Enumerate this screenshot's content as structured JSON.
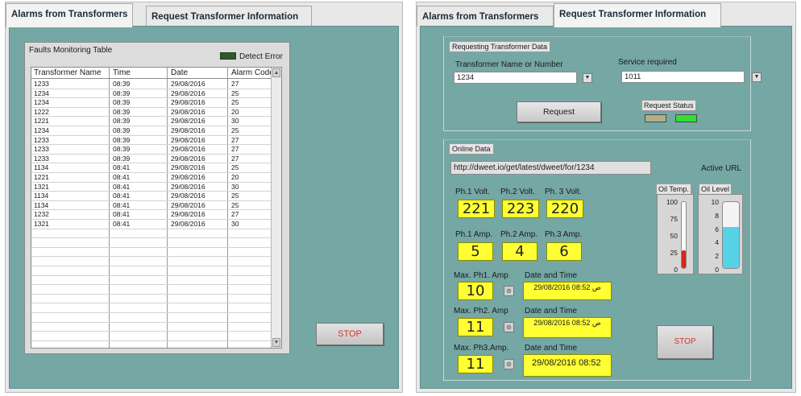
{
  "left": {
    "tabs": [
      "Alarms from Transformers",
      "Request Transformer Information"
    ],
    "faults_title": "Faults Monitoring Table",
    "detect_error_label": "Detect Error",
    "table": {
      "columns": [
        "Transformer Name",
        "Time",
        "Date",
        "Alarm Code"
      ],
      "rows": [
        [
          "1233",
          "08:39",
          "29/08/2016",
          "27"
        ],
        [
          "1234",
          "08:39",
          "29/08/2016",
          "25"
        ],
        [
          "1234",
          "08:39",
          "29/08/2016",
          "25"
        ],
        [
          "1222",
          "08:39",
          "29/08/2016",
          "20"
        ],
        [
          "1221",
          "08:39",
          "29/08/2016",
          "30"
        ],
        [
          "1234",
          "08:39",
          "29/08/2016",
          "25"
        ],
        [
          "1233",
          "08:39",
          "29/08/2016",
          "27"
        ],
        [
          "1233",
          "08:39",
          "29/08/2016",
          "27"
        ],
        [
          "1233",
          "08:39",
          "29/08/2016",
          "27"
        ],
        [
          "1134",
          "08:41",
          "29/08/2016",
          "25"
        ],
        [
          "1221",
          "08:41",
          "29/08/2016",
          "20"
        ],
        [
          "1321",
          "08:41",
          "29/08/2016",
          "30"
        ],
        [
          "1134",
          "08:41",
          "29/08/2016",
          "25"
        ],
        [
          "1134",
          "08:41",
          "29/08/2016",
          "25"
        ],
        [
          "1232",
          "08:41",
          "29/08/2016",
          "27"
        ],
        [
          "1321",
          "08:41",
          "29/08/2016",
          "30"
        ]
      ]
    },
    "stop_label": "STOP"
  },
  "right": {
    "tabs": [
      "Alarms from Transformers",
      "Request Transformer Information"
    ],
    "request_group_title": "Requesting Transformer Data",
    "transformer_label": "Transformer Name or Number",
    "transformer_value": "1234",
    "service_label": "Service required",
    "service_value": "1011",
    "request_button": "Request",
    "request_status_label": "Request Status",
    "online_group_title": "Online  Data",
    "url_value": "http://dweet.io/get/latest/dweet/for/1234",
    "active_url_label": "Active URL",
    "volt_labels": [
      "Ph.1 Volt.",
      "Ph.2 Volt.",
      "Ph. 3 Volt."
    ],
    "volt_values": [
      "221",
      "223",
      "220"
    ],
    "amp_labels": [
      "Ph.1 Amp.",
      "Ph.2 Amp.",
      "Ph.3 Amp."
    ],
    "amp_values": [
      "5",
      "4",
      "6"
    ],
    "max_labels": [
      "Max. Ph1. Amp",
      "Max. Ph2. Amp",
      "Max. Ph3.Amp."
    ],
    "max_values": [
      "10",
      "11",
      "11"
    ],
    "date_time_label": "Date and Time",
    "date_values": [
      "29/08/2016 08:52 ص",
      "29/08/2016 08:52 ص",
      "29/08/2016 08:52"
    ],
    "oil_temp_label": "Oil Temp.",
    "oil_temp_ticks": [
      "100",
      "75",
      "50",
      "25",
      "0"
    ],
    "oil_temp_level": 0.27,
    "oil_level_label": "Oil Level",
    "oil_level_ticks": [
      "10",
      "8",
      "6",
      "4",
      "2",
      "0"
    ],
    "oil_level_level": 0.62,
    "stop_label": "STOP"
  },
  "colors": {
    "panel": "#75a7a4",
    "indicator": "#ffff33",
    "led_green": "#33dd33",
    "led_off": "#b3ad8c",
    "thermo_red": "#d8241e",
    "oil_cyan": "#55d2e6",
    "stop_text": "#d8322a"
  },
  "icons": {
    "dropdown": "dropdown-arrow-icon",
    "reset": "reset-icon",
    "scroll_up": "scroll-up-arrow-icon",
    "scroll_down": "scroll-down-arrow-icon"
  }
}
